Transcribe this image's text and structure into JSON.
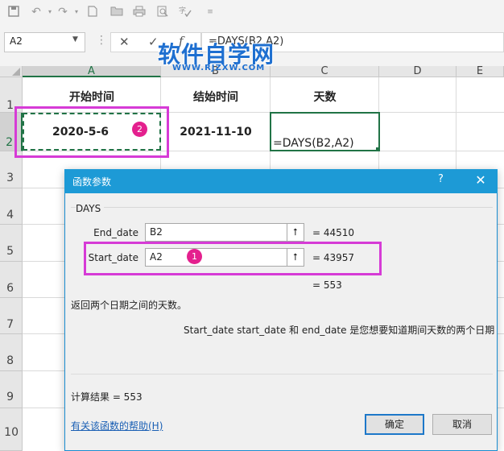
{
  "formula_bar": {
    "name_box": "A2",
    "cancel_glyph": "✕",
    "enter_glyph": "✓",
    "fx_glyph": "f",
    "formula": "=DAYS(B2,A2)"
  },
  "watermark": {
    "main": "软件自学网",
    "sub": "WWW.RJZXW.COM"
  },
  "columns": [
    "A",
    "B",
    "C",
    "D",
    "E"
  ],
  "rows": [
    "1",
    "2",
    "3",
    "4",
    "5",
    "6",
    "7",
    "8",
    "9",
    "10"
  ],
  "cells": {
    "A1": "开始时间",
    "B1": "结始时间",
    "C1": "天数",
    "A2": "2020-5-6",
    "B2": "2021-11-10",
    "C2": "=DAYS(B2,A2)"
  },
  "callouts": {
    "one": "1",
    "two": "2",
    "color": "#e4208e"
  },
  "dialog": {
    "title": "函数参数",
    "help": "?",
    "close": "✕",
    "function_name": "DAYS",
    "args": [
      {
        "label": "End_date",
        "value": "B2",
        "result": "= 44510"
      },
      {
        "label": "Start_date",
        "value": "A2",
        "result": "= 43957"
      }
    ],
    "arg_button": "⭡",
    "total": "= 553",
    "function_description": "返回两个日期之间的天数。",
    "arg_description": "Start_date   start_date 和 end_date 是您想要知道期间天数的两个日期",
    "calc_result": "计算结果 =   553",
    "help_link": "有关该函数的帮助(H)",
    "ok": "确定",
    "cancel": "取消"
  },
  "colors": {
    "accent": "#217346",
    "titlebar": "#1d9ad6",
    "highlight": "#d63bd6"
  }
}
